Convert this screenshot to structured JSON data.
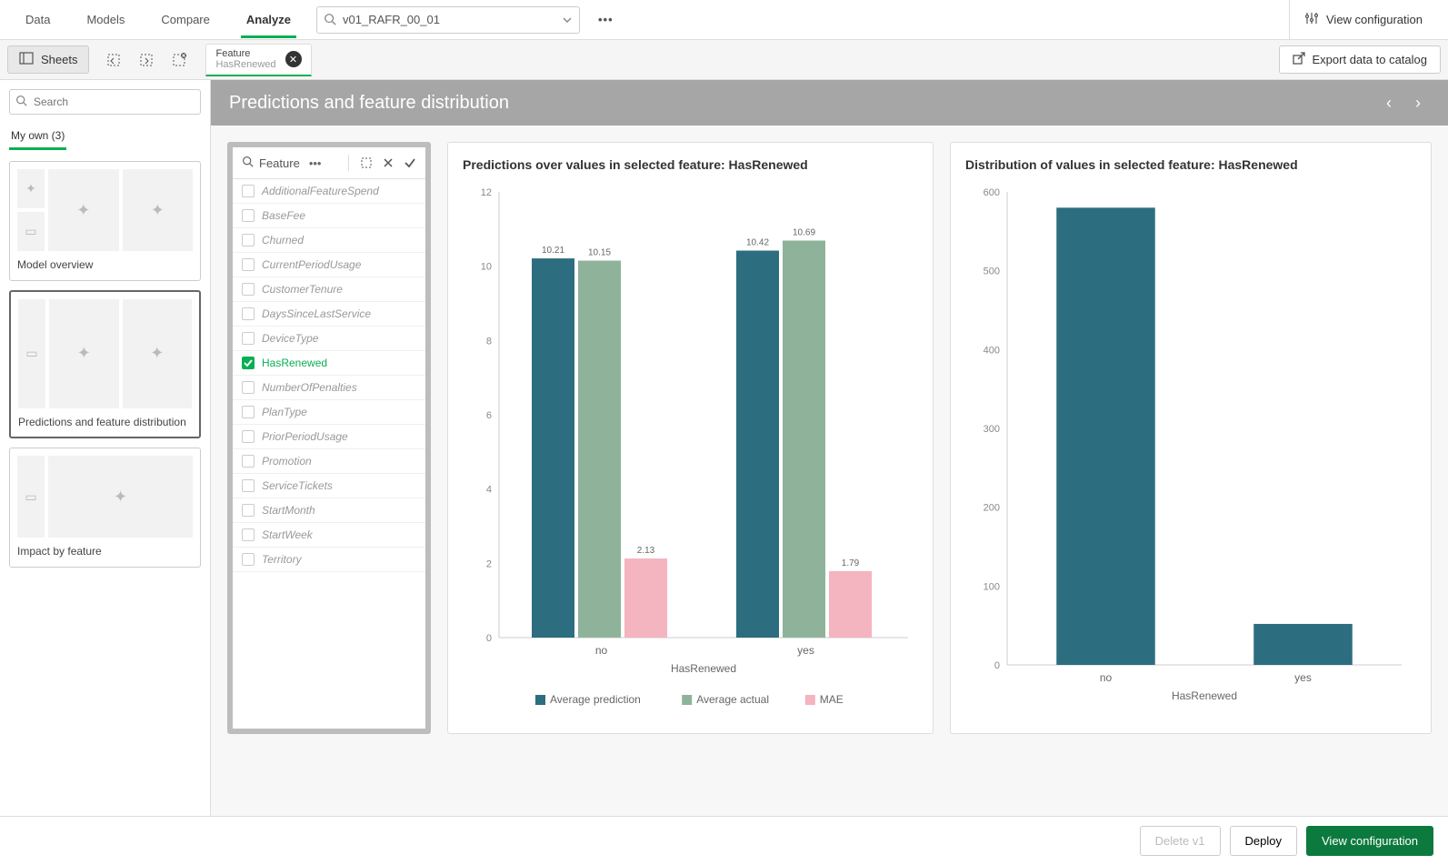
{
  "topnav": {
    "tabs": [
      "Data",
      "Models",
      "Compare",
      "Analyze"
    ],
    "active_tab": 3,
    "search_value": "v01_RAFR_00_01",
    "view_config": "View configuration"
  },
  "secondbar": {
    "sheets": "Sheets",
    "feature_tab_label": "Feature",
    "feature_tab_value": "HasRenewed",
    "export": "Export data to catalog"
  },
  "sidebar": {
    "search_placeholder": "Search",
    "tab_label": "My own (3)",
    "sheets": [
      {
        "label": "Model overview"
      },
      {
        "label": "Predictions and feature distribution"
      },
      {
        "label": "Impact by feature"
      }
    ],
    "selected_index": 1
  },
  "banner": {
    "title": "Predictions and feature distribution"
  },
  "feature_panel": {
    "header": "Feature",
    "items": [
      "AdditionalFeatureSpend",
      "BaseFee",
      "Churned",
      "CurrentPeriodUsage",
      "CustomerTenure",
      "DaysSinceLastService",
      "DeviceType",
      "HasRenewed",
      "NumberOfPenalties",
      "PlanType",
      "PriorPeriodUsage",
      "Promotion",
      "ServiceTickets",
      "StartMonth",
      "StartWeek",
      "Territory"
    ],
    "selected": "HasRenewed"
  },
  "chart1_title": "Predictions over values in selected feature: HasRenewed",
  "chart2_title": "Distribution of values in selected feature: HasRenewed",
  "chart_data": [
    {
      "type": "bar",
      "title": "Predictions over values in selected feature: HasRenewed",
      "xlabel": "HasRenewed",
      "ylabel": "",
      "categories": [
        "no",
        "yes"
      ],
      "series": [
        {
          "name": "Average prediction",
          "values": [
            10.21,
            10.42
          ],
          "color": "#2c6e7f"
        },
        {
          "name": "Average actual",
          "values": [
            10.15,
            10.69
          ],
          "color": "#8fb39a"
        },
        {
          "name": "MAE",
          "values": [
            2.13,
            1.79
          ],
          "color": "#f4b4c0"
        }
      ],
      "ylim": [
        0,
        12
      ],
      "yticks": [
        0,
        2,
        4,
        6,
        8,
        10,
        12
      ]
    },
    {
      "type": "bar",
      "title": "Distribution of values in selected feature: HasRenewed",
      "xlabel": "HasRenewed",
      "ylabel": "",
      "categories": [
        "no",
        "yes"
      ],
      "values": [
        580,
        52
      ],
      "color": "#2c6e7f",
      "ylim": [
        0,
        600
      ],
      "yticks": [
        0,
        100,
        200,
        300,
        400,
        500,
        600
      ]
    }
  ],
  "footer": {
    "delete": "Delete v1",
    "deploy": "Deploy",
    "view_config": "View configuration"
  }
}
